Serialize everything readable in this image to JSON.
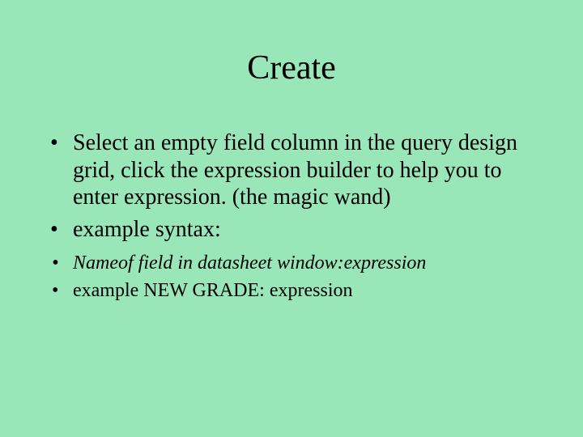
{
  "title": "Create",
  "bullets_big": [
    "Select an empty field column in the query design grid, click the expression builder to help you to enter expression. (the magic wand)",
    "example syntax:"
  ],
  "bullets_small": [
    {
      "text": "Nameof field in datasheet window:expression",
      "italic": true
    },
    {
      "text": "example NEW GRADE: expression",
      "italic": false
    }
  ]
}
